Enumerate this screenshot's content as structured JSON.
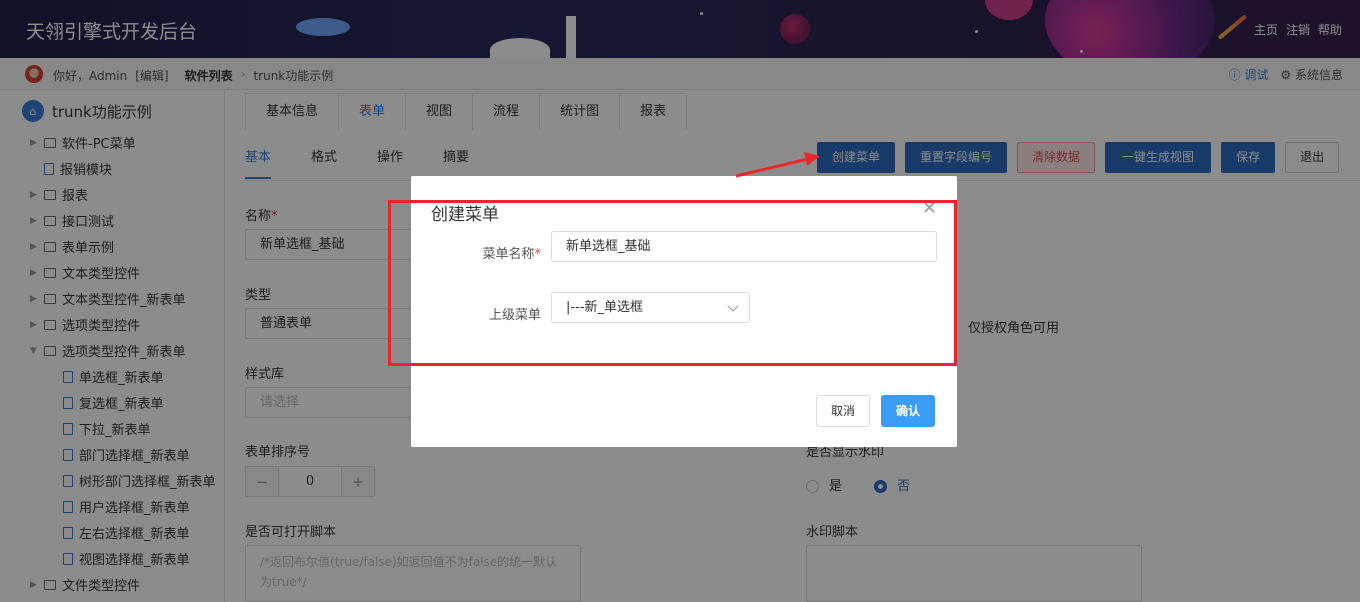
{
  "header": {
    "title": "天翎引擎式开发后台",
    "links": [
      "主页",
      "注销",
      "帮助"
    ]
  },
  "crumbbar": {
    "greeting": "你好，Admin",
    "edit_link": "[编辑]",
    "section": "软件列表",
    "page": "trunk功能示例",
    "debug": "ⓘ 调试",
    "sysinfo": "⚙ 系统信息"
  },
  "sidebar": {
    "root": "trunk功能示例",
    "items": [
      {
        "label": "软件-PC菜单",
        "type": "folder",
        "state": "collapsed"
      },
      {
        "label": "报销模块",
        "type": "file",
        "state": "none"
      },
      {
        "label": "报表",
        "type": "folder",
        "state": "collapsed"
      },
      {
        "label": "接口测试",
        "type": "folder",
        "state": "collapsed"
      },
      {
        "label": "表单示例",
        "type": "folder",
        "state": "collapsed"
      },
      {
        "label": "文本类型控件",
        "type": "folder",
        "state": "collapsed"
      },
      {
        "label": "文本类型控件_新表单",
        "type": "folder",
        "state": "collapsed"
      },
      {
        "label": "选项类型控件",
        "type": "folder",
        "state": "collapsed"
      },
      {
        "label": "选项类型控件_新表单",
        "type": "folder",
        "state": "expanded"
      },
      {
        "label": "单选框_新表单",
        "type": "file",
        "state": "child"
      },
      {
        "label": "复选框_新表单",
        "type": "file",
        "state": "child"
      },
      {
        "label": "下拉_新表单",
        "type": "file",
        "state": "child"
      },
      {
        "label": "部门选择框_新表单",
        "type": "file",
        "state": "child"
      },
      {
        "label": "树形部门选择框_新表单",
        "type": "file",
        "state": "child"
      },
      {
        "label": "用户选择框_新表单",
        "type": "file",
        "state": "child"
      },
      {
        "label": "左右选择框_新表单",
        "type": "file",
        "state": "child"
      },
      {
        "label": "视图选择框_新表单",
        "type": "file",
        "state": "child"
      },
      {
        "label": "文件类型控件",
        "type": "folder",
        "state": "collapsed"
      }
    ]
  },
  "top_tabs": [
    "基本信息",
    "表单",
    "视图",
    "流程",
    "统计图",
    "报表"
  ],
  "sub_tabs": [
    "基本",
    "格式",
    "操作",
    "摘要"
  ],
  "toolbar": {
    "create_menu": "创建菜单",
    "reset_field": "重置字段编号",
    "clear_data": "清除数据",
    "gen_view": "一键生成视图",
    "save": "保存",
    "exit": "退出"
  },
  "form": {
    "name_label": "名称",
    "name_value": "新单选框_基础",
    "type_label": "类型",
    "type_value": "普通表单",
    "style_label": "样式库",
    "style_placeholder": "请选择",
    "order_label": "表单排序号",
    "order_value": "0",
    "script_label": "是否可打开脚本",
    "script_placeholder": "/*返回布尔值(true/false)如返回值不为false的统一默认为true*/",
    "role_text": "仅授权角色可用",
    "watermark_label": "是否显示水印",
    "watermark_yes": "是",
    "watermark_no": "否",
    "watermark_script_label": "水印脚本"
  },
  "modal": {
    "title": "创建菜单",
    "menu_name_label": "菜单名称",
    "menu_name_value": "新单选框_基础",
    "parent_label": "上级菜单",
    "parent_value": "|---新_单选框",
    "cancel": "取消",
    "ok": "确认"
  }
}
